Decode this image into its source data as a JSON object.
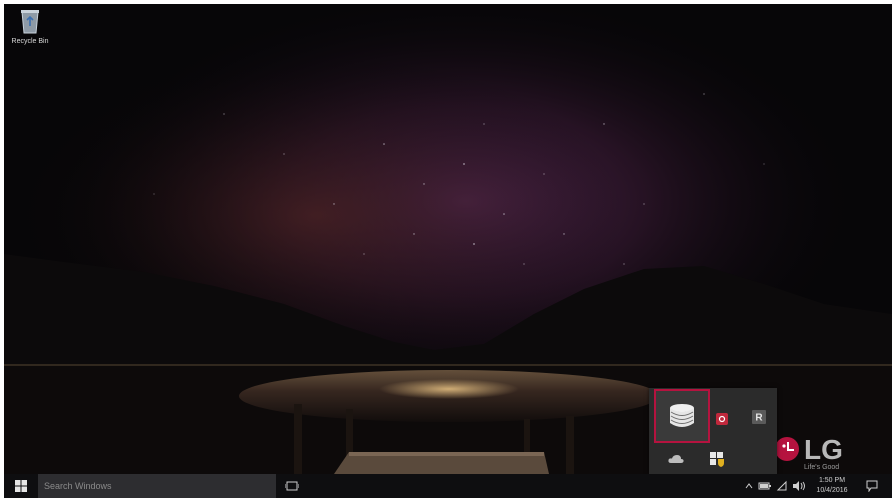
{
  "desktop": {
    "recycle_bin_label": "Recycle Bin"
  },
  "brand": {
    "logo_text": "LG",
    "tagline": "Life's Good",
    "logo_color": "#b5133f"
  },
  "tray_popup": {
    "highlight_color": "#b5133f",
    "icons": [
      "lg-control-center-icon",
      "red-app-icon",
      "r-app-icon",
      "onedrive-cloud-icon",
      "security-shield-icon"
    ],
    "r_app_letter": "R"
  },
  "taskbar": {
    "search_placeholder": "Search Windows",
    "time": "1:50 PM",
    "date": "10/4/2016"
  }
}
